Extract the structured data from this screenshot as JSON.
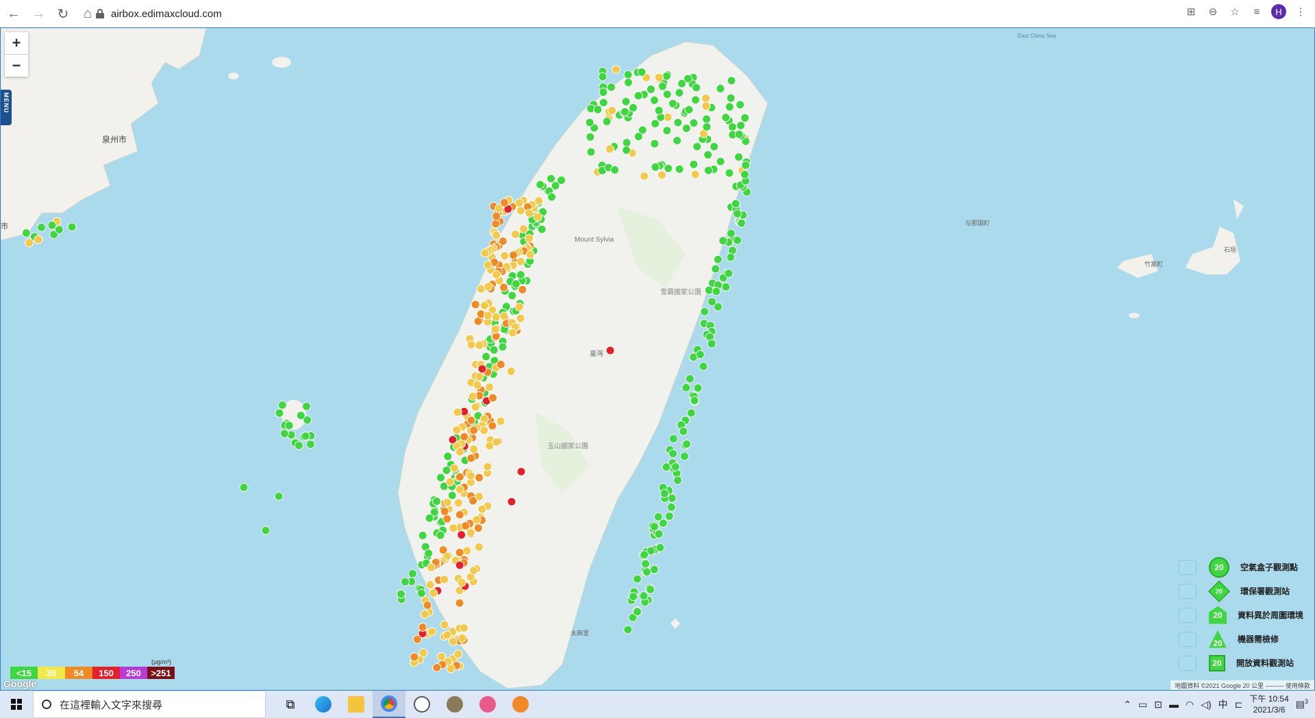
{
  "browser": {
    "url": "airbox.edimaxcloud.com",
    "profile_initial": "H"
  },
  "map": {
    "zoom_in": "+",
    "zoom_out": "−",
    "menu_label": "MENU",
    "place_labels": {
      "quanzhou": "泉州市",
      "east_china_sea": "East China Sea",
      "mount_sylvia": "Mount Sylvia",
      "taiwan": "臺灣",
      "yushan_park": "玉山國家公園",
      "shei_pa_park": "雪霸國家公園",
      "taimali": "太麻里",
      "yonaguni": "与那国町",
      "taketomi": "竹富町",
      "ishigaki": "石垣",
      "city_fragment": "市"
    },
    "pm_scale": [
      {
        "label": "<15",
        "color": "#3fd73f"
      },
      {
        "label": "35",
        "color": "#f2e84a"
      },
      {
        "label": "54",
        "color": "#f08a24"
      },
      {
        "label": "150",
        "color": "#e4202a"
      },
      {
        "label": "250",
        "color": "#b93bd6"
      },
      {
        "label": ">251",
        "color": "#7b1014"
      }
    ],
    "pm_unit": "(μg/m³)",
    "legend": [
      {
        "label": "空氣盒子觀測點",
        "value": "20",
        "shape": "circle"
      },
      {
        "label": "環保署觀測站",
        "value": "20",
        "shape": "diamond"
      },
      {
        "label": "資料異於周圍環境",
        "value": "20",
        "shape": "house"
      },
      {
        "label": "機器需檢修",
        "value": "20",
        "shape": "triangle"
      },
      {
        "label": "開放資料觀測站",
        "value": "20",
        "shape": "square"
      }
    ],
    "google": "Google",
    "attribution": "地圖資料 ©2021 Google   20 公里 ———   使用條款"
  },
  "taskbar": {
    "search_placeholder": "在這裡輸入文字來搜尋",
    "time": "下午 10:54",
    "date": "2021/3/6",
    "ime": "中",
    "notification_count": "3"
  }
}
